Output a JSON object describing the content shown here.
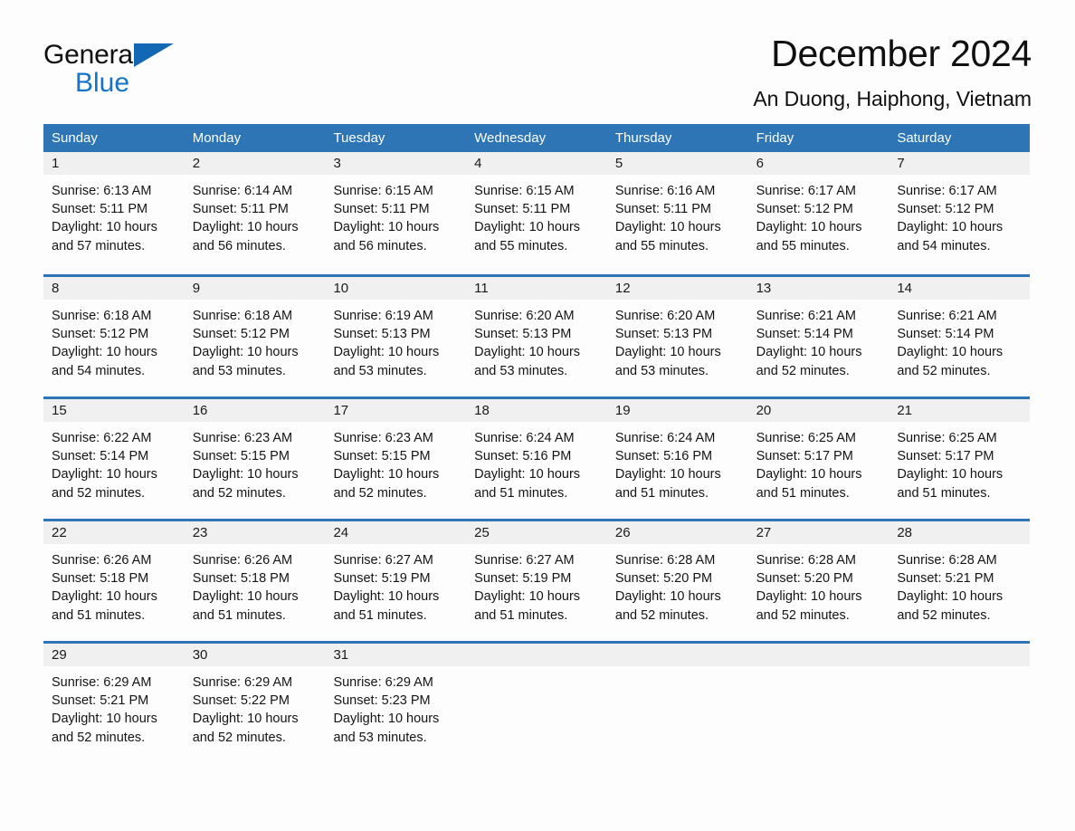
{
  "brand": {
    "name_part1": "General",
    "name_part2": "Blue",
    "flag_icon": "triangle-flag-icon"
  },
  "header": {
    "title": "December 2024",
    "location": "An Duong, Haiphong, Vietnam"
  },
  "colors": {
    "header_blue": "#2E75B6",
    "brand_blue": "#1773C4",
    "daynum_band": "#F0F0F0",
    "page_background": "#FDFDFD",
    "text": "#1A1A1A"
  },
  "calendar": {
    "weekday_headers": [
      "Sunday",
      "Monday",
      "Tuesday",
      "Wednesday",
      "Thursday",
      "Friday",
      "Saturday"
    ],
    "weeks": [
      [
        {
          "day": "1",
          "sunrise": "Sunrise: 6:13 AM",
          "sunset": "Sunset: 5:11 PM",
          "daylight": "Daylight: 10 hours and 57 minutes."
        },
        {
          "day": "2",
          "sunrise": "Sunrise: 6:14 AM",
          "sunset": "Sunset: 5:11 PM",
          "daylight": "Daylight: 10 hours and 56 minutes."
        },
        {
          "day": "3",
          "sunrise": "Sunrise: 6:15 AM",
          "sunset": "Sunset: 5:11 PM",
          "daylight": "Daylight: 10 hours and 56 minutes."
        },
        {
          "day": "4",
          "sunrise": "Sunrise: 6:15 AM",
          "sunset": "Sunset: 5:11 PM",
          "daylight": "Daylight: 10 hours and 55 minutes."
        },
        {
          "day": "5",
          "sunrise": "Sunrise: 6:16 AM",
          "sunset": "Sunset: 5:11 PM",
          "daylight": "Daylight: 10 hours and 55 minutes."
        },
        {
          "day": "6",
          "sunrise": "Sunrise: 6:17 AM",
          "sunset": "Sunset: 5:12 PM",
          "daylight": "Daylight: 10 hours and 55 minutes."
        },
        {
          "day": "7",
          "sunrise": "Sunrise: 6:17 AM",
          "sunset": "Sunset: 5:12 PM",
          "daylight": "Daylight: 10 hours and 54 minutes."
        }
      ],
      [
        {
          "day": "8",
          "sunrise": "Sunrise: 6:18 AM",
          "sunset": "Sunset: 5:12 PM",
          "daylight": "Daylight: 10 hours and 54 minutes."
        },
        {
          "day": "9",
          "sunrise": "Sunrise: 6:18 AM",
          "sunset": "Sunset: 5:12 PM",
          "daylight": "Daylight: 10 hours and 53 minutes."
        },
        {
          "day": "10",
          "sunrise": "Sunrise: 6:19 AM",
          "sunset": "Sunset: 5:13 PM",
          "daylight": "Daylight: 10 hours and 53 minutes."
        },
        {
          "day": "11",
          "sunrise": "Sunrise: 6:20 AM",
          "sunset": "Sunset: 5:13 PM",
          "daylight": "Daylight: 10 hours and 53 minutes."
        },
        {
          "day": "12",
          "sunrise": "Sunrise: 6:20 AM",
          "sunset": "Sunset: 5:13 PM",
          "daylight": "Daylight: 10 hours and 53 minutes."
        },
        {
          "day": "13",
          "sunrise": "Sunrise: 6:21 AM",
          "sunset": "Sunset: 5:14 PM",
          "daylight": "Daylight: 10 hours and 52 minutes."
        },
        {
          "day": "14",
          "sunrise": "Sunrise: 6:21 AM",
          "sunset": "Sunset: 5:14 PM",
          "daylight": "Daylight: 10 hours and 52 minutes."
        }
      ],
      [
        {
          "day": "15",
          "sunrise": "Sunrise: 6:22 AM",
          "sunset": "Sunset: 5:14 PM",
          "daylight": "Daylight: 10 hours and 52 minutes."
        },
        {
          "day": "16",
          "sunrise": "Sunrise: 6:23 AM",
          "sunset": "Sunset: 5:15 PM",
          "daylight": "Daylight: 10 hours and 52 minutes."
        },
        {
          "day": "17",
          "sunrise": "Sunrise: 6:23 AM",
          "sunset": "Sunset: 5:15 PM",
          "daylight": "Daylight: 10 hours and 52 minutes."
        },
        {
          "day": "18",
          "sunrise": "Sunrise: 6:24 AM",
          "sunset": "Sunset: 5:16 PM",
          "daylight": "Daylight: 10 hours and 51 minutes."
        },
        {
          "day": "19",
          "sunrise": "Sunrise: 6:24 AM",
          "sunset": "Sunset: 5:16 PM",
          "daylight": "Daylight: 10 hours and 51 minutes."
        },
        {
          "day": "20",
          "sunrise": "Sunrise: 6:25 AM",
          "sunset": "Sunset: 5:17 PM",
          "daylight": "Daylight: 10 hours and 51 minutes."
        },
        {
          "day": "21",
          "sunrise": "Sunrise: 6:25 AM",
          "sunset": "Sunset: 5:17 PM",
          "daylight": "Daylight: 10 hours and 51 minutes."
        }
      ],
      [
        {
          "day": "22",
          "sunrise": "Sunrise: 6:26 AM",
          "sunset": "Sunset: 5:18 PM",
          "daylight": "Daylight: 10 hours and 51 minutes."
        },
        {
          "day": "23",
          "sunrise": "Sunrise: 6:26 AM",
          "sunset": "Sunset: 5:18 PM",
          "daylight": "Daylight: 10 hours and 51 minutes."
        },
        {
          "day": "24",
          "sunrise": "Sunrise: 6:27 AM",
          "sunset": "Sunset: 5:19 PM",
          "daylight": "Daylight: 10 hours and 51 minutes."
        },
        {
          "day": "25",
          "sunrise": "Sunrise: 6:27 AM",
          "sunset": "Sunset: 5:19 PM",
          "daylight": "Daylight: 10 hours and 51 minutes."
        },
        {
          "day": "26",
          "sunrise": "Sunrise: 6:28 AM",
          "sunset": "Sunset: 5:20 PM",
          "daylight": "Daylight: 10 hours and 52 minutes."
        },
        {
          "day": "27",
          "sunrise": "Sunrise: 6:28 AM",
          "sunset": "Sunset: 5:20 PM",
          "daylight": "Daylight: 10 hours and 52 minutes."
        },
        {
          "day": "28",
          "sunrise": "Sunrise: 6:28 AM",
          "sunset": "Sunset: 5:21 PM",
          "daylight": "Daylight: 10 hours and 52 minutes."
        }
      ],
      [
        {
          "day": "29",
          "sunrise": "Sunrise: 6:29 AM",
          "sunset": "Sunset: 5:21 PM",
          "daylight": "Daylight: 10 hours and 52 minutes."
        },
        {
          "day": "30",
          "sunrise": "Sunrise: 6:29 AM",
          "sunset": "Sunset: 5:22 PM",
          "daylight": "Daylight: 10 hours and 52 minutes."
        },
        {
          "day": "31",
          "sunrise": "Sunrise: 6:29 AM",
          "sunset": "Sunset: 5:23 PM",
          "daylight": "Daylight: 10 hours and 53 minutes."
        },
        {
          "day": "",
          "sunrise": "",
          "sunset": "",
          "daylight": ""
        },
        {
          "day": "",
          "sunrise": "",
          "sunset": "",
          "daylight": ""
        },
        {
          "day": "",
          "sunrise": "",
          "sunset": "",
          "daylight": ""
        },
        {
          "day": "",
          "sunrise": "",
          "sunset": "",
          "daylight": ""
        }
      ]
    ]
  }
}
